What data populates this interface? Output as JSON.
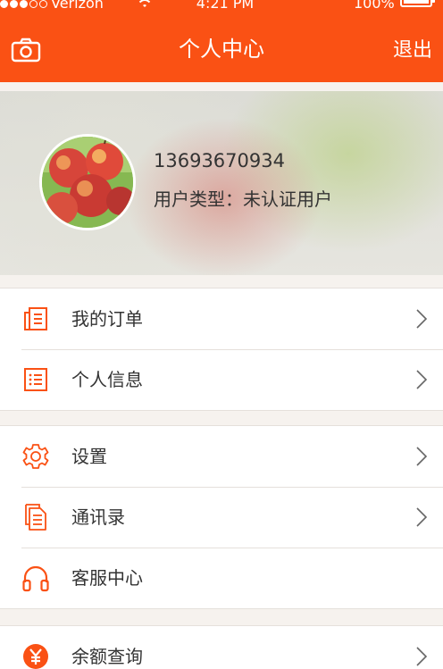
{
  "status_bar": {
    "carrier": "Verizon",
    "time": "4:21 PM",
    "battery": "100%"
  },
  "header": {
    "title": "个人中心",
    "logout": "退出",
    "camera_icon": "camera-icon"
  },
  "profile": {
    "phone": "13693670934",
    "user_type": "用户类型：未认证用户",
    "avatar": "apples-photo"
  },
  "menu": {
    "group1": [
      {
        "label": "我的订单",
        "icon": "order-icon"
      },
      {
        "label": "个人信息",
        "icon": "list-icon"
      }
    ],
    "group2": [
      {
        "label": "设置",
        "icon": "gear-icon"
      },
      {
        "label": "通讯录",
        "icon": "contacts-icon"
      },
      {
        "label": "客服中心",
        "icon": "headphones-icon"
      }
    ],
    "group3": [
      {
        "label": "余额查询",
        "icon": "yen-icon"
      }
    ]
  },
  "colors": {
    "accent": "#fa5114",
    "background": "#f6f2ee"
  }
}
